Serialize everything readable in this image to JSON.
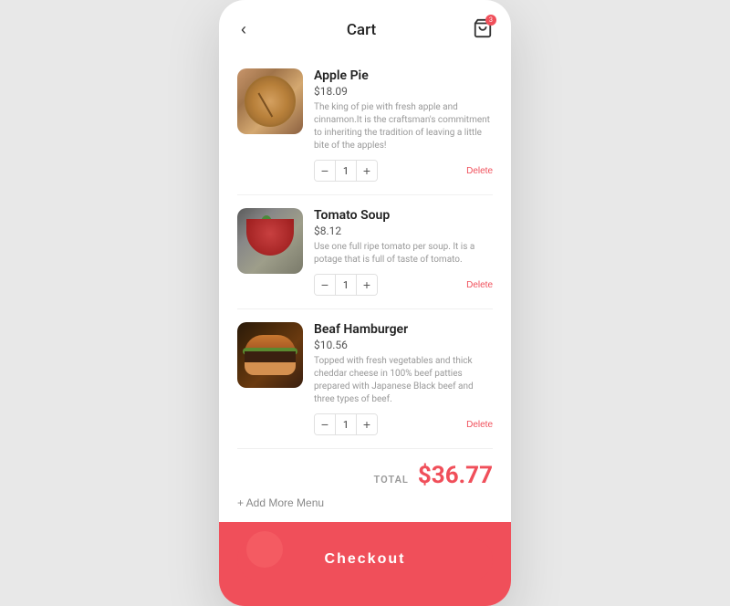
{
  "header": {
    "title": "Cart",
    "back_label": "‹",
    "cart_badge": "3"
  },
  "items": [
    {
      "id": "apple-pie",
      "name": "Apple Pie",
      "price": "$18.09",
      "description": "The king of pie with fresh apple and cinnamon.It is the craftsman's commitment to inheriting the tradition of leaving a little bite of the apples!",
      "quantity": "1",
      "delete_label": "Delete",
      "type": "apple"
    },
    {
      "id": "tomato-soup",
      "name": "Tomato Soup",
      "price": "$8.12",
      "description": "Use one full ripe tomato per soup. It is a potage that is full of taste of tomato.",
      "quantity": "1",
      "delete_label": "Delete",
      "type": "tomato"
    },
    {
      "id": "beef-hamburger",
      "name": "Beaf Hamburger",
      "price": "$10.56",
      "description": "Topped with fresh vegetables and thick cheddar cheese in 100% beef patties prepared with Japanese Black beef and three types of beef.",
      "quantity": "1",
      "delete_label": "Delete",
      "type": "burger"
    }
  ],
  "footer": {
    "total_label": "TOTAL",
    "total_amount": "$36.77",
    "add_more_label": "+ Add More Menu"
  },
  "checkout": {
    "button_label": "Checkout"
  }
}
